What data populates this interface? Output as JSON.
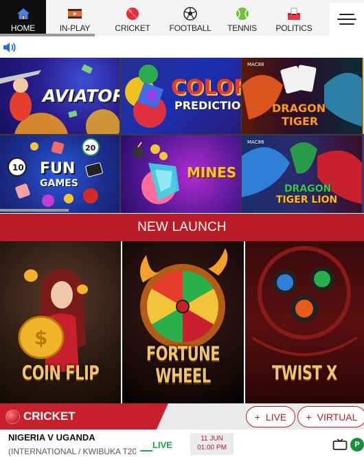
{
  "nav": {
    "items": [
      {
        "label": "HOME",
        "icon": "home-icon",
        "active": true
      },
      {
        "label": "IN-PLAY",
        "icon": "inplay-icon",
        "active": false
      },
      {
        "label": "CRICKET",
        "icon": "cricket-ball-icon",
        "active": false
      },
      {
        "label": "FOOTBALL",
        "icon": "football-icon",
        "active": false
      },
      {
        "label": "TENNIS",
        "icon": "tennis-ball-icon",
        "active": false
      },
      {
        "label": "POLITICS",
        "icon": "politics-icon",
        "active": false
      }
    ],
    "menu_icon": "hamburger-icon"
  },
  "announce": {
    "icon": "speaker-icon"
  },
  "casino": {
    "tiles": [
      {
        "title": "AVIATOR"
      },
      {
        "title_line1": "COLOR",
        "title_line2": "PREDICTION"
      },
      {
        "title_line1": "DRAGON",
        "title_line2": "TIGER"
      },
      {
        "title_line1": "FUN",
        "title_line2": "GAMES"
      },
      {
        "title": "MINES"
      },
      {
        "title_line1": "DRAGON",
        "title_line2": "TIGER LION"
      }
    ]
  },
  "new_launch": {
    "heading": "NEW LAUNCH",
    "games": [
      {
        "title": "COIN FLIP"
      },
      {
        "title": "FORTUNE WHEEL"
      },
      {
        "title": "TWIST X"
      }
    ]
  },
  "sport_section": {
    "label": "CRICKET",
    "live_button": "LIVE",
    "virtual_button": "VIRTUAL",
    "plus": "+"
  },
  "match": {
    "name": "NIGERIA V UGANDA",
    "sub": "(INTERNATIONAL / KWIBUKA T20...",
    "status": "LIVE",
    "date": "11 JUN",
    "time": "01:00 PM",
    "badge": "P"
  },
  "colors": {
    "brand_red": "#b91c28",
    "live_green": "#1aa34a",
    "nav_active": "#0f0f0f"
  }
}
